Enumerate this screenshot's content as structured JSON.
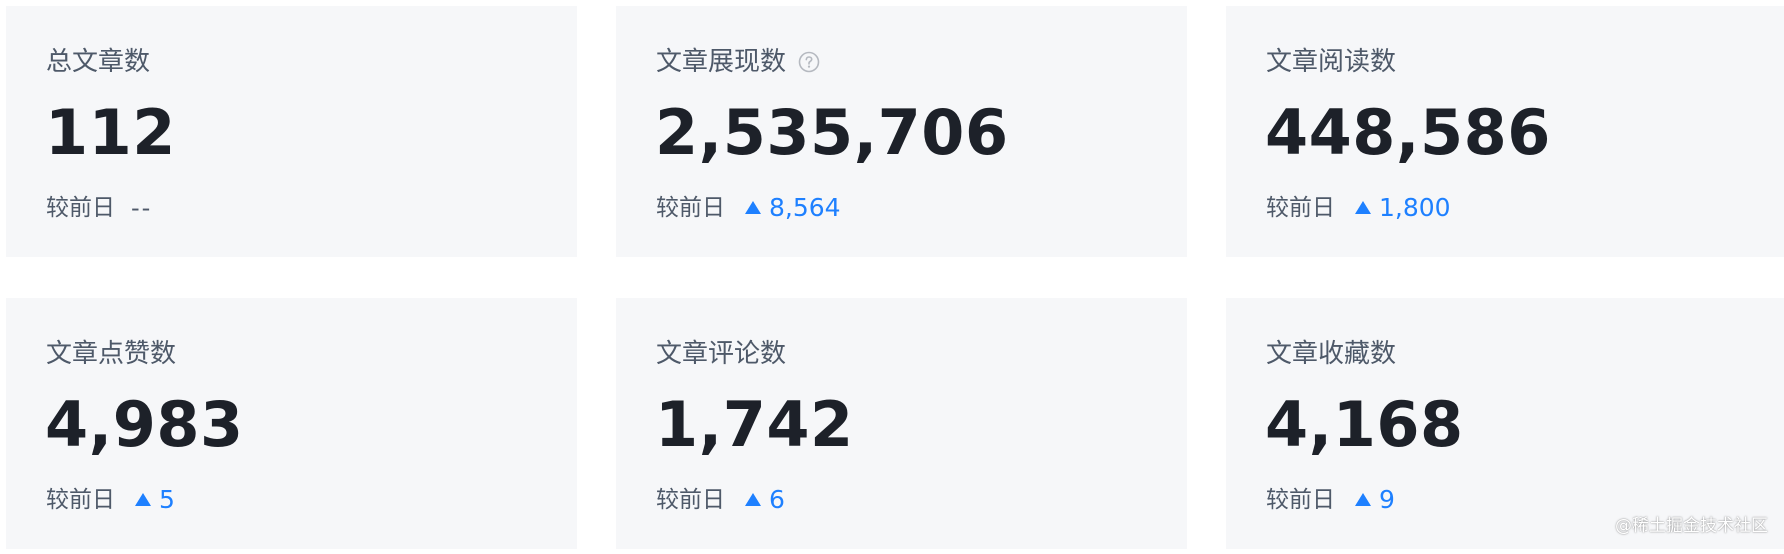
{
  "compare_label": "较前日",
  "accent_color": "#1e80ff",
  "cards": [
    {
      "label": "总文章数",
      "value": "112",
      "compare": "较前日",
      "delta": "--",
      "trend": "none"
    },
    {
      "label": "文章展现数",
      "value": "2,535,706",
      "compare": "较前日",
      "delta": "8,564",
      "trend": "up",
      "icon": "question-circle-icon"
    },
    {
      "label": "文章阅读数",
      "value": "448,586",
      "compare": "较前日",
      "delta": "1,800",
      "trend": "up"
    },
    {
      "label": "文章点赞数",
      "value": "4,983",
      "compare": "较前日",
      "delta": "5",
      "trend": "up"
    },
    {
      "label": "文章评论数",
      "value": "1,742",
      "compare": "较前日",
      "delta": "6",
      "trend": "up"
    },
    {
      "label": "文章收藏数",
      "value": "4,168",
      "compare": "较前日",
      "delta": "9",
      "trend": "up"
    }
  ],
  "watermark": "@稀土掘金技术社区"
}
